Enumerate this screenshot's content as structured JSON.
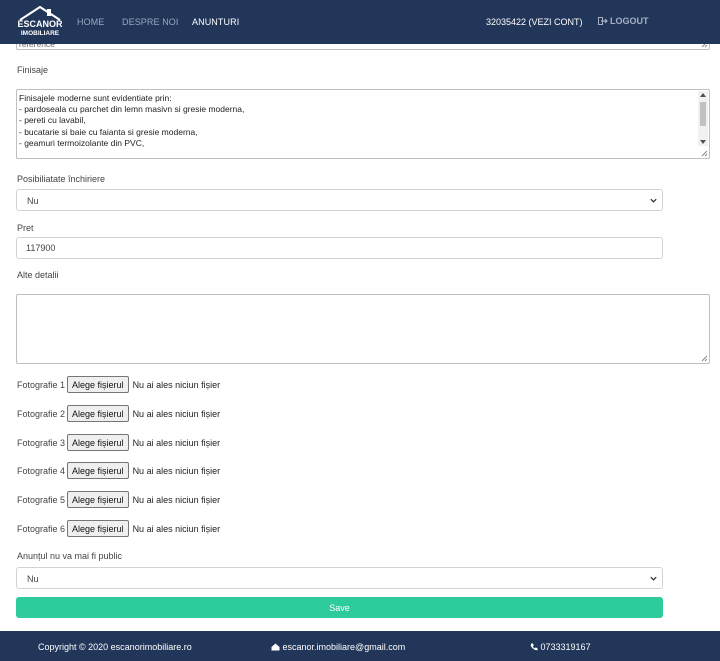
{
  "brand": {
    "line1": "ESCANOR",
    "line2": "IMOBILIARE"
  },
  "nav": {
    "home": "HOME",
    "about": "DESPRE NOI",
    "ads": "ANUNTURI",
    "account": "32035422 (VEZI CONT)",
    "logout": "LOGOUT"
  },
  "form": {
    "top_text_fragment": "reference",
    "finisaje": {
      "label": "Finisaje",
      "text": "Finisajele moderne sunt evidentiate prin:\n- pardoseala cu parchet din lemn masivn si gresie moderna,\n- pereti cu lavabil,\n- bucatarie si baie cu faianta si gresie moderna,\n- geamuri termoizolante din PVC,"
    },
    "inchiriere": {
      "label": "Posibiliatate închiriere",
      "value": "Nu"
    },
    "pret": {
      "label": "Pret",
      "value": "117900"
    },
    "alte_detalii": {
      "label": "Alte detalii",
      "value": ""
    },
    "photos": [
      {
        "label": "Fotografie 1",
        "button": "Alege fișierul",
        "status": "Nu ai ales niciun fișier"
      },
      {
        "label": "Fotografie 2",
        "button": "Alege fișierul",
        "status": "Nu ai ales niciun fișier"
      },
      {
        "label": "Fotografie 3",
        "button": "Alege fișierul",
        "status": "Nu ai ales niciun fișier"
      },
      {
        "label": "Fotografie 4",
        "button": "Alege fișierul",
        "status": "Nu ai ales niciun fișier"
      },
      {
        "label": "Fotografie 5",
        "button": "Alege fișierul",
        "status": "Nu ai ales niciun fișier"
      },
      {
        "label": "Fotografie 6",
        "button": "Alege fișierul",
        "status": "Nu ai ales niciun fișier"
      }
    ],
    "public": {
      "label": "Anunțul nu va mai fi public",
      "value": "Nu"
    },
    "save_label": "Save"
  },
  "footer": {
    "copyright": "Copyright © 2020 escanorimobiliare.ro",
    "email": "escanor.imobiliare@gmail.com",
    "phone": "0733319167"
  },
  "colors": {
    "navbar": "#223659",
    "accent": "#2ecc9d"
  }
}
